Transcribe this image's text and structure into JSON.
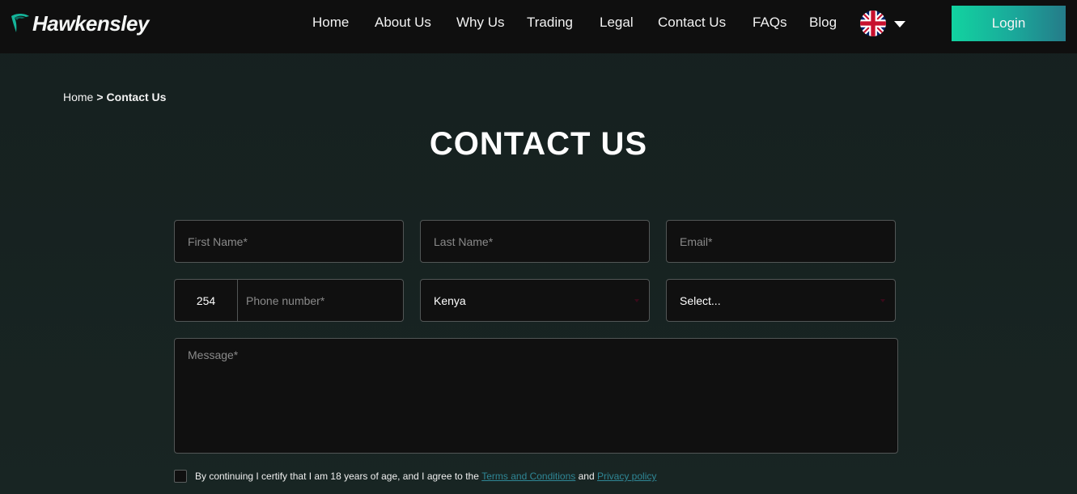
{
  "header": {
    "brand": "Hawkensley",
    "nav": [
      {
        "label": "Home"
      },
      {
        "label": "About Us"
      },
      {
        "label": "Why Us"
      },
      {
        "label": "Trading"
      },
      {
        "label": "Legal"
      },
      {
        "label": "Contact Us"
      },
      {
        "label": "FAQs"
      },
      {
        "label": "Blog"
      }
    ],
    "language_icon": "uk-flag-icon",
    "login_label": "Login",
    "accent_gradient": [
      "#12d3a0",
      "#257b89"
    ]
  },
  "breadcrumb": {
    "home": "Home",
    "separator": ">",
    "current": "Contact Us"
  },
  "page_title": "CONTACT US",
  "form": {
    "first_name_placeholder": "First Name*",
    "last_name_placeholder": "Last Name*",
    "email_placeholder": "Email*",
    "phone_code": "254",
    "phone_placeholder": "Phone number*",
    "country_value": "Kenya",
    "select_value": "Select...",
    "message_placeholder": "Message*",
    "consent_text": "By continuing I certify that I am 18 years of age, and I agree to the",
    "terms_link": "Terms and Conditions",
    "and_text": "and",
    "privacy_link": "Privacy policy",
    "link_color": "#2f8796"
  }
}
